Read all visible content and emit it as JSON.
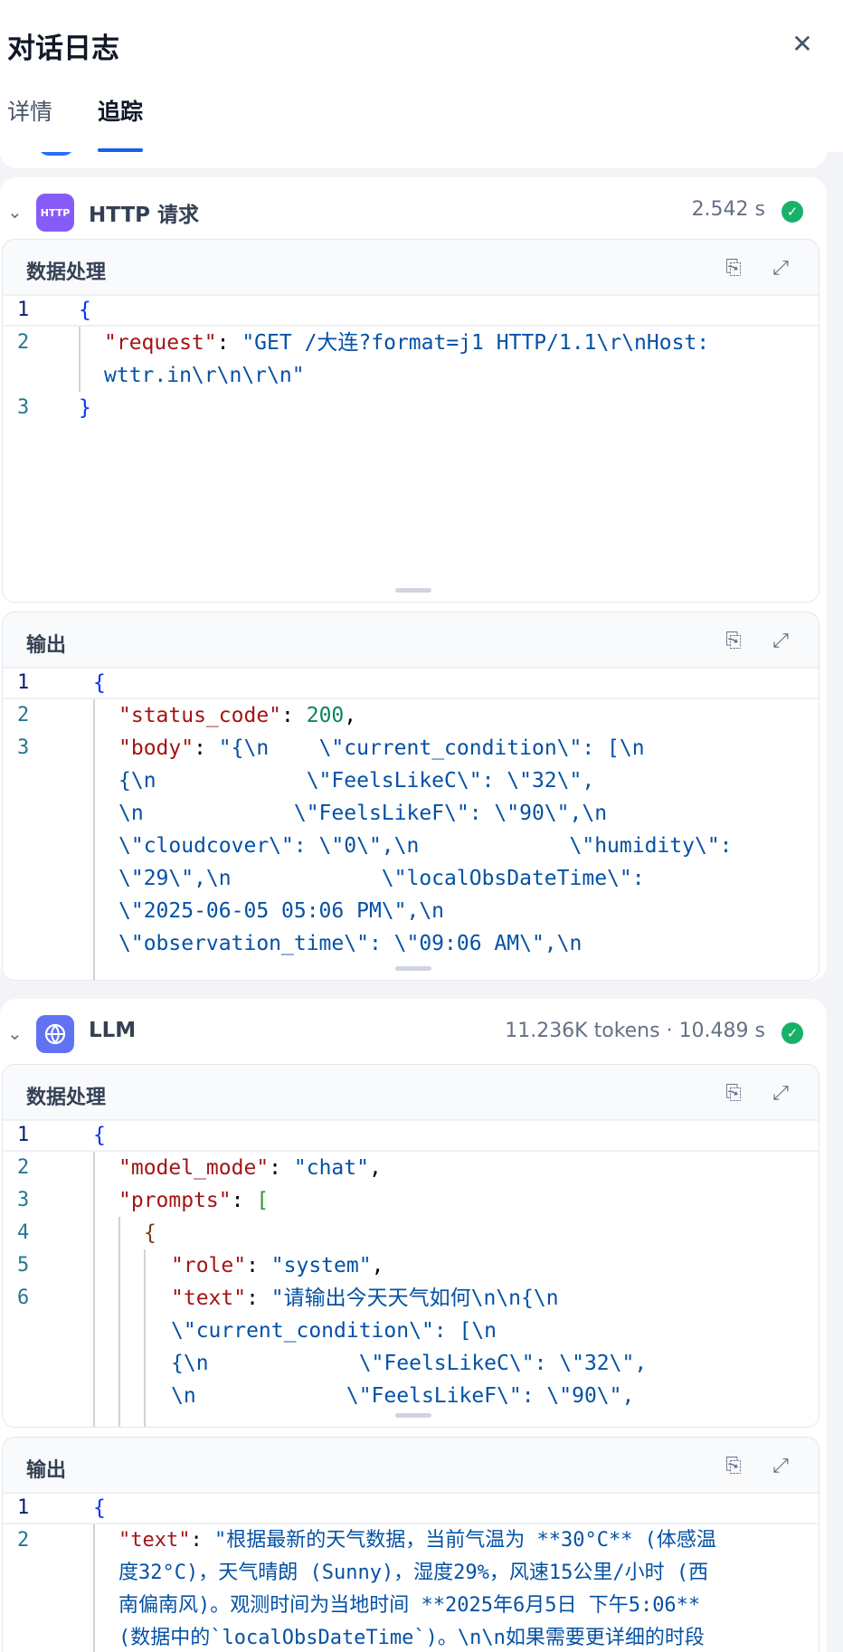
{
  "header": {
    "title": "对话日志",
    "close_icon": "close-icon"
  },
  "tabs": [
    {
      "label": "详情"
    },
    {
      "label": "追踪",
      "active": true
    }
  ],
  "nodes": [
    {
      "title": "HTTP 请求",
      "icon_text": "HTTP",
      "meta": "2.542 s",
      "status": "success",
      "panels": [
        {
          "label": "数据处理",
          "line_numbers": [
            "1",
            "2",
            "3"
          ],
          "code": {
            "l1": "{",
            "l2_key": "\"request\"",
            "l2_sep": ": ",
            "l2_val": "\"GET /大连?format=j1 HTTP/1.1\\r\\nHost:",
            "l2_wrap": "wttr.in\\r\\n\\r\\n\"",
            "l3": "}"
          }
        },
        {
          "label": "输出",
          "line_numbers": [
            "1",
            "2",
            "3"
          ],
          "code": {
            "l1": "{",
            "l2_key": "\"status_code\"",
            "l2_sep": ": ",
            "l2_val": "200",
            "l2_end": ",",
            "l3_key": "\"body\"",
            "l3_sep": ": ",
            "l3_val": "\"{\\n    \\\"current_condition\\\": [\\n",
            "wrap": [
              "{\\n            \\\"FeelsLikeC\\\": \\\"32\\\",",
              "\\n            \\\"FeelsLikeF\\\": \\\"90\\\",\\n",
              "\\\"cloudcover\\\": \\\"0\\\",\\n            \\\"humidity\\\":",
              "\\\"29\\\",\\n            \\\"localObsDateTime\\\":",
              "\\\"2025-06-05 05:06 PM\\\",\\n",
              "\\\"observation_time\\\": \\\"09:06 AM\\\",\\n"
            ]
          }
        }
      ]
    },
    {
      "title": "LLM",
      "icon": "brain-icon",
      "meta": "11.236K tokens · 10.489 s",
      "status": "success",
      "panels": [
        {
          "label": "数据处理",
          "line_numbers": [
            "1",
            "2",
            "3",
            "4",
            "5",
            "6"
          ],
          "code": {
            "l1": "{",
            "l2_key": "\"model_mode\"",
            "l2_sep": ": ",
            "l2_val": "\"chat\"",
            "l2_end": ",",
            "l3_key": "\"prompts\"",
            "l3_sep": ": ",
            "l3_val": "[",
            "l4": "{",
            "l5_key": "\"role\"",
            "l5_sep": ": ",
            "l5_val": "\"system\"",
            "l5_end": ",",
            "l6_key": "\"text\"",
            "l6_sep": ": ",
            "l6_val": "\"请输出今天天气如何\\n\\n{\\n",
            "wrap": [
              "\\\"current_condition\\\": [\\n",
              "{\\n            \\\"FeelsLikeC\\\": \\\"32\\\",",
              "\\n            \\\"FeelsLikeF\\\": \\\"90\\\","
            ]
          }
        },
        {
          "label": "输出",
          "line_numbers": [
            "1",
            "2"
          ],
          "code": {
            "l1": "{",
            "l2_key": "\"text\"",
            "l2_sep": ": ",
            "l2_val": "\"根据最新的天气数据，当前气温为 **30°C** (体感温",
            "wrap": [
              "度32°C)，天气晴朗 (Sunny)，湿度29%，风速15公里/小时 (西",
              "南偏南风)。观测时间为当地时间 **2025年6月5日 下午5:06**",
              "(数据中的`localObsDateTime`)。\\n\\n如果需要更详细的时段"
            ]
          }
        }
      ]
    }
  ],
  "icons": {
    "copy": "clipboard-icon",
    "expand": "expand-icon",
    "chevron": "chevron-down-icon",
    "check": "check-circle-icon"
  },
  "colors": {
    "accent": "#155eef",
    "success": "#17b26a",
    "http_icon": "#875bf7",
    "llm_icon": "#6172f3"
  }
}
